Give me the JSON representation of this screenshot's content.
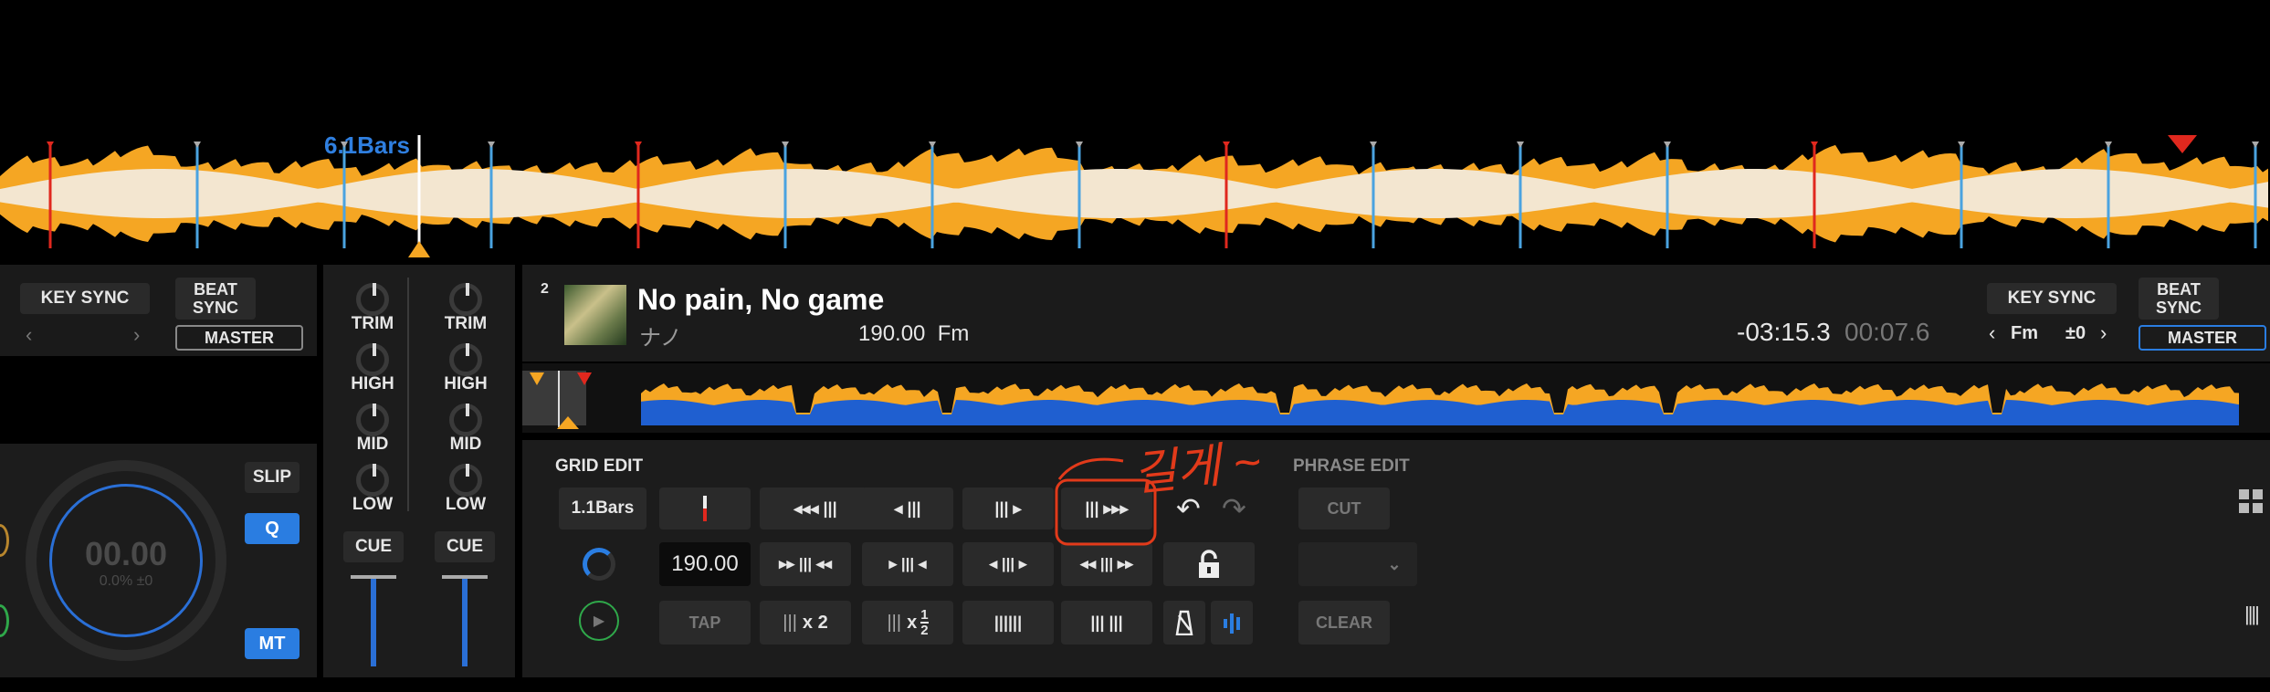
{
  "top_waveform": {
    "bar_readout": "6.1Bars"
  },
  "left_deck": {
    "key_sync_label": "KEY SYNC",
    "beat_sync_label": "BEAT\nSYNC",
    "master_label": "MASTER",
    "slip_label": "SLIP",
    "q_label": "Q",
    "mt_label": "MT",
    "jog_value": "00.00",
    "jog_sub": "0.0% ±0"
  },
  "mixer": {
    "channels": [
      {
        "trim": "TRIM",
        "high": "HIGH",
        "mid": "MID",
        "low": "LOW",
        "cue": "CUE"
      },
      {
        "trim": "TRIM",
        "high": "HIGH",
        "mid": "MID",
        "low": "LOW",
        "cue": "CUE"
      }
    ]
  },
  "right_deck": {
    "deck_number": "2",
    "track_title": "No pain, No game",
    "artist": "ナノ",
    "bpm_key": "190.00  Fm",
    "remaining_time": "-03:15.3",
    "elapsed_time": "00:07.6",
    "key_sync_label": "KEY SYNC",
    "beat_sync_label": "BEAT\nSYNC",
    "key_value": "Fm",
    "key_shift": "±0",
    "master_label": "MASTER"
  },
  "grid_edit": {
    "title": "GRID EDIT",
    "bars_button": "1.1Bars",
    "bpm_value": "190.00",
    "tap_label": "TAP",
    "times2": "x 2",
    "half_x": "x",
    "half_num": "1",
    "half_den": "2"
  },
  "phrase_edit": {
    "title": "PHRASE EDIT",
    "cut_label": "CUT",
    "clear_label": "CLEAR"
  },
  "annotation": {
    "handwritten": "길게 ~"
  },
  "colors": {
    "accent_blue": "#2a7de1",
    "wave_orange": "#f5a623",
    "wave_white": "#f3e6d0",
    "marker_red": "#e0281e",
    "annotation_red": "#e23a1a"
  }
}
